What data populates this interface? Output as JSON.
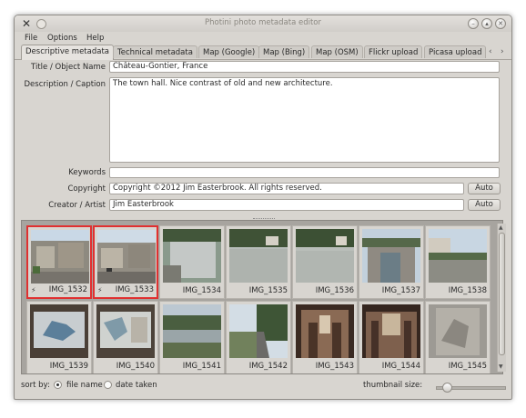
{
  "window": {
    "title": "Photini photo metadata editor"
  },
  "menu": [
    "File",
    "Options",
    "Help"
  ],
  "tabs": [
    "Descriptive metadata",
    "Technical metadata",
    "Map (Google)",
    "Map (Bing)",
    "Map (OSM)",
    "Flickr upload",
    "Picasa upload"
  ],
  "form": {
    "title_label": "Title / Object Name",
    "title_value": "Château-Gontier, France",
    "description_label": "Description / Caption",
    "description_value": "The town hall. Nice contrast of old and new architecture.",
    "keywords_label": "Keywords",
    "keywords_value": "",
    "copyright_label": "Copyright",
    "copyright_value": "Copyright ©2012 Jim Easterbrook. All rights reserved.",
    "creator_label": "Creator / Artist",
    "creator_value": "Jim Easterbrook",
    "auto_label": "Auto"
  },
  "thumbnails": [
    {
      "name": "IMG_1532",
      "selected": true,
      "flag": "⚡"
    },
    {
      "name": "IMG_1533",
      "selected": true,
      "flag": "⚡"
    },
    {
      "name": "IMG_1534",
      "selected": false,
      "flag": ""
    },
    {
      "name": "IMG_1535",
      "selected": false,
      "flag": ""
    },
    {
      "name": "IMG_1536",
      "selected": false,
      "flag": ""
    },
    {
      "name": "IMG_1537",
      "selected": false,
      "flag": ""
    },
    {
      "name": "IMG_1538",
      "selected": false,
      "flag": ""
    },
    {
      "name": "IMG_1539",
      "selected": false,
      "flag": ""
    },
    {
      "name": "IMG_1540",
      "selected": false,
      "flag": ""
    },
    {
      "name": "IMG_1541",
      "selected": false,
      "flag": ""
    },
    {
      "name": "IMG_1542",
      "selected": false,
      "flag": ""
    },
    {
      "name": "IMG_1543",
      "selected": false,
      "flag": ""
    },
    {
      "name": "IMG_1544",
      "selected": false,
      "flag": ""
    },
    {
      "name": "IMG_1545",
      "selected": false,
      "flag": ""
    }
  ],
  "footer": {
    "sort_by_label": "sort by:",
    "sort_option_filename": "file name",
    "sort_option_date": "date taken",
    "sort_selected": "file name",
    "thumbnail_size_label": "thumbnail size:"
  },
  "colors": {
    "selection_border": "#e03030",
    "window_bg": "#d8d5d0",
    "thumb_area_bg": "#a7a49f"
  }
}
